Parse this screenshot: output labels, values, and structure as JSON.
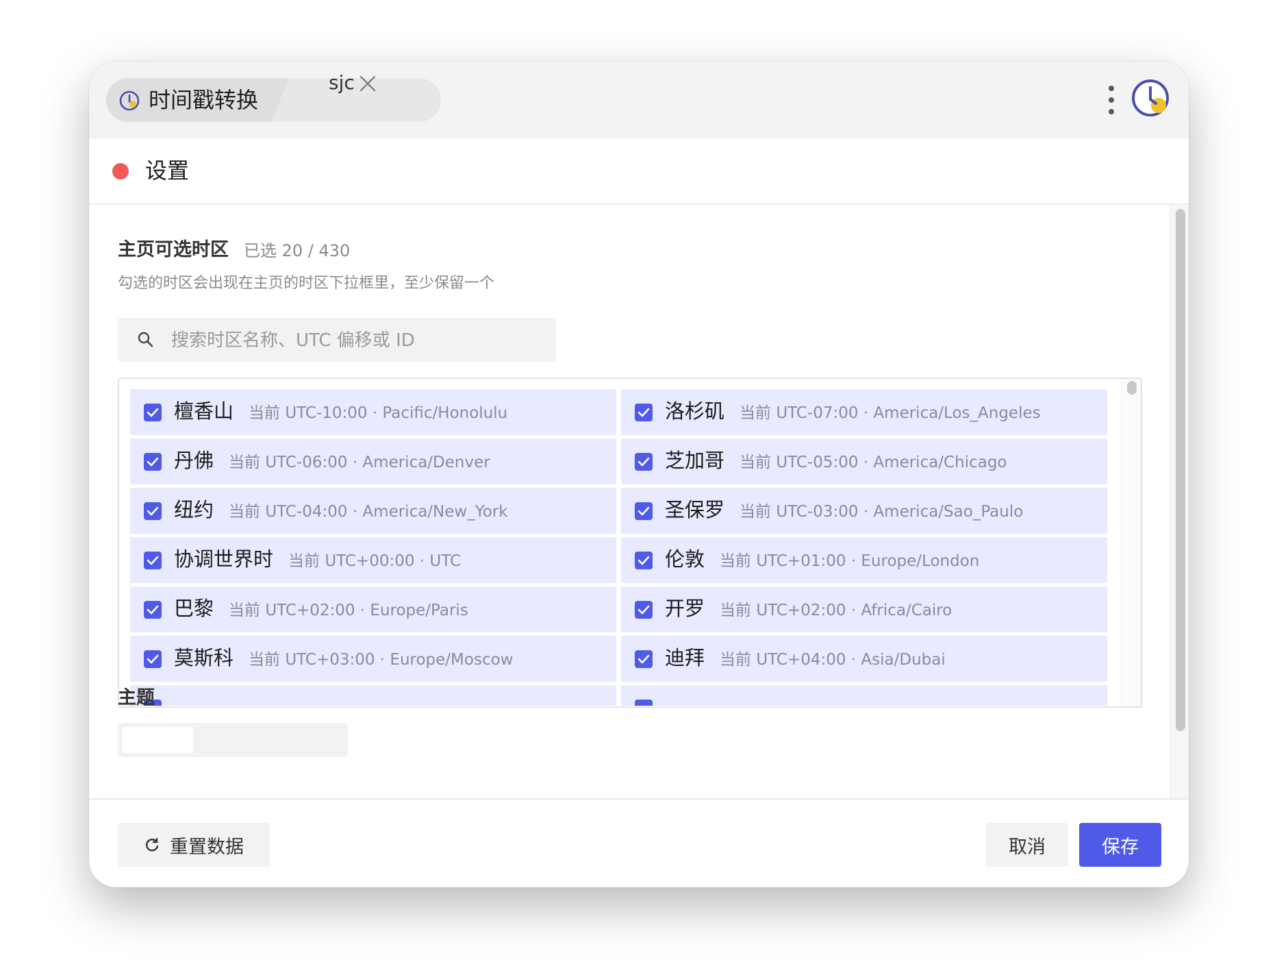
{
  "window": {
    "tab_title": "时间戳转换",
    "sub_tab_label": "sjc"
  },
  "settings": {
    "title": "设置",
    "timezones": {
      "section_title": "主页可选时区",
      "selected_count": "已选 20 / 430",
      "description": "勾选的时区会出现在主页的时区下拉框里，至少保留一个",
      "search_placeholder": "搜索时区名称、UTC 偏移或 ID",
      "items": [
        {
          "name": "檀香山",
          "meta": "当前 UTC-10:00 · Pacific/Honolulu",
          "checked": true
        },
        {
          "name": "洛杉矶",
          "meta": "当前 UTC-07:00 · America/Los_Angeles",
          "checked": true
        },
        {
          "name": "丹佛",
          "meta": "当前 UTC-06:00 · America/Denver",
          "checked": true
        },
        {
          "name": "芝加哥",
          "meta": "当前 UTC-05:00 · America/Chicago",
          "checked": true
        },
        {
          "name": "纽约",
          "meta": "当前 UTC-04:00 · America/New_York",
          "checked": true
        },
        {
          "name": "圣保罗",
          "meta": "当前 UTC-03:00 · America/Sao_Paulo",
          "checked": true
        },
        {
          "name": "协调世界时",
          "meta": "当前 UTC+00:00 · UTC",
          "checked": true
        },
        {
          "name": "伦敦",
          "meta": "当前 UTC+01:00 · Europe/London",
          "checked": true
        },
        {
          "name": "巴黎",
          "meta": "当前 UTC+02:00 · Europe/Paris",
          "checked": true
        },
        {
          "name": "开罗",
          "meta": "当前 UTC+02:00 · Africa/Cairo",
          "checked": true
        },
        {
          "name": "莫斯科",
          "meta": "当前 UTC+03:00 · Europe/Moscow",
          "checked": true
        },
        {
          "name": "迪拜",
          "meta": "当前 UTC+04:00 · Asia/Dubai",
          "checked": true
        }
      ]
    },
    "theme": {
      "section_title": "主题"
    }
  },
  "footer": {
    "reset_label": "重置数据",
    "cancel_label": "取消",
    "save_label": "保存"
  },
  "colors": {
    "accent": "#4f5be8",
    "item_bg": "#e8eaff",
    "status_dot": "#f25a57",
    "logo_ring": "#4a4fa8",
    "logo_dot": "#f2c12e"
  },
  "icons": {
    "tab": "clock-icon",
    "close": "close-icon",
    "menu": "kebab-menu-icon",
    "logo": "app-clock-logo-icon",
    "search": "search-icon",
    "check": "checkmark-icon",
    "reset": "refresh-icon"
  }
}
